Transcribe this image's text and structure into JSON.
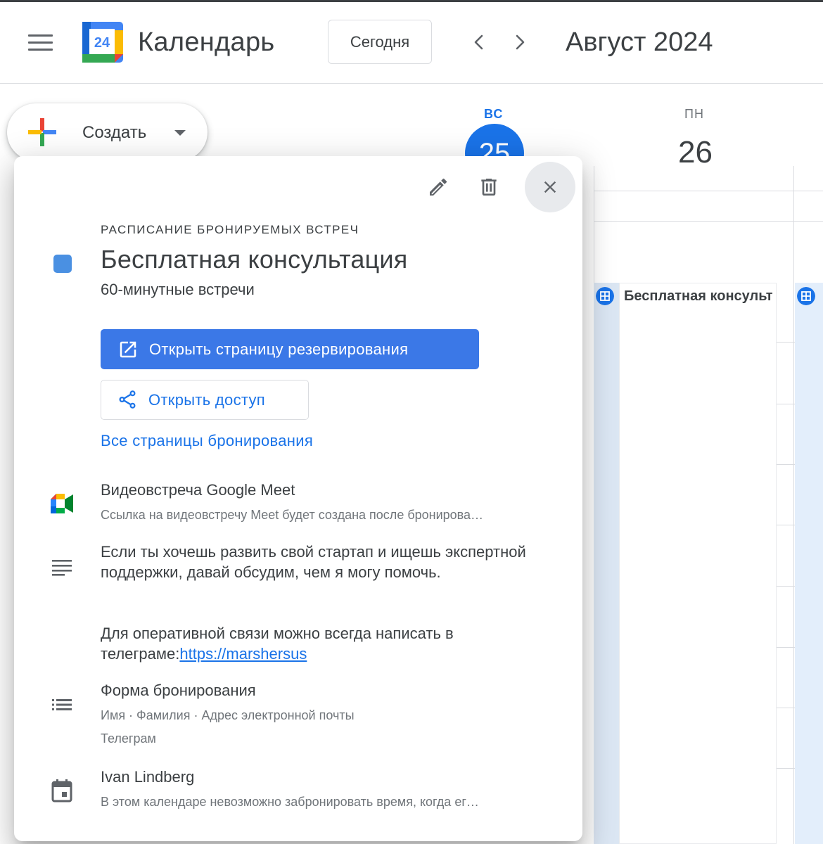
{
  "header": {
    "app_title": "Календарь",
    "logo_day": "24",
    "today_label": "Сегодня",
    "month_title": "Август 2024"
  },
  "create": {
    "label": "Создать"
  },
  "days": [
    {
      "dow": "ВС",
      "num": "25",
      "today": true
    },
    {
      "dow": "ПН",
      "num": "26",
      "today": false
    }
  ],
  "grid_event": {
    "title": "Бесплатная консульт"
  },
  "popup": {
    "kicker": "РАСПИСАНИЕ БРОНИРУЕМЫХ ВСТРЕЧ",
    "title": "Бесплатная консультация",
    "subtitle": "60-минутные встречи",
    "color": "#4a90e2",
    "open_booking_label": "Открыть страницу резервирования",
    "share_label": "Открыть доступ",
    "all_pages_label": "Все страницы бронирования",
    "meet": {
      "title": "Видеовстреча Google Meet",
      "subtitle": "Ссылка на видеовстречу Meet будет создана после бронирова…"
    },
    "description": {
      "paragraph1": "Если ты хочешь развить свой стартап и ищешь экспертной поддержки, давай обсудим, чем я могу помочь.",
      "paragraph2_prefix": "Для оперативной связи можно всегда написать в телеграме:",
      "link_text": "https://marshersus"
    },
    "form": {
      "title": "Форма бронирования",
      "fields_line1": "Имя · Фамилия · Адрес электронной почты",
      "fields_line2": "Телеграм"
    },
    "calendar": {
      "owner": "Ivan Lindberg",
      "note": "В этом календаре невозможно забронировать время, когда ег…"
    }
  }
}
